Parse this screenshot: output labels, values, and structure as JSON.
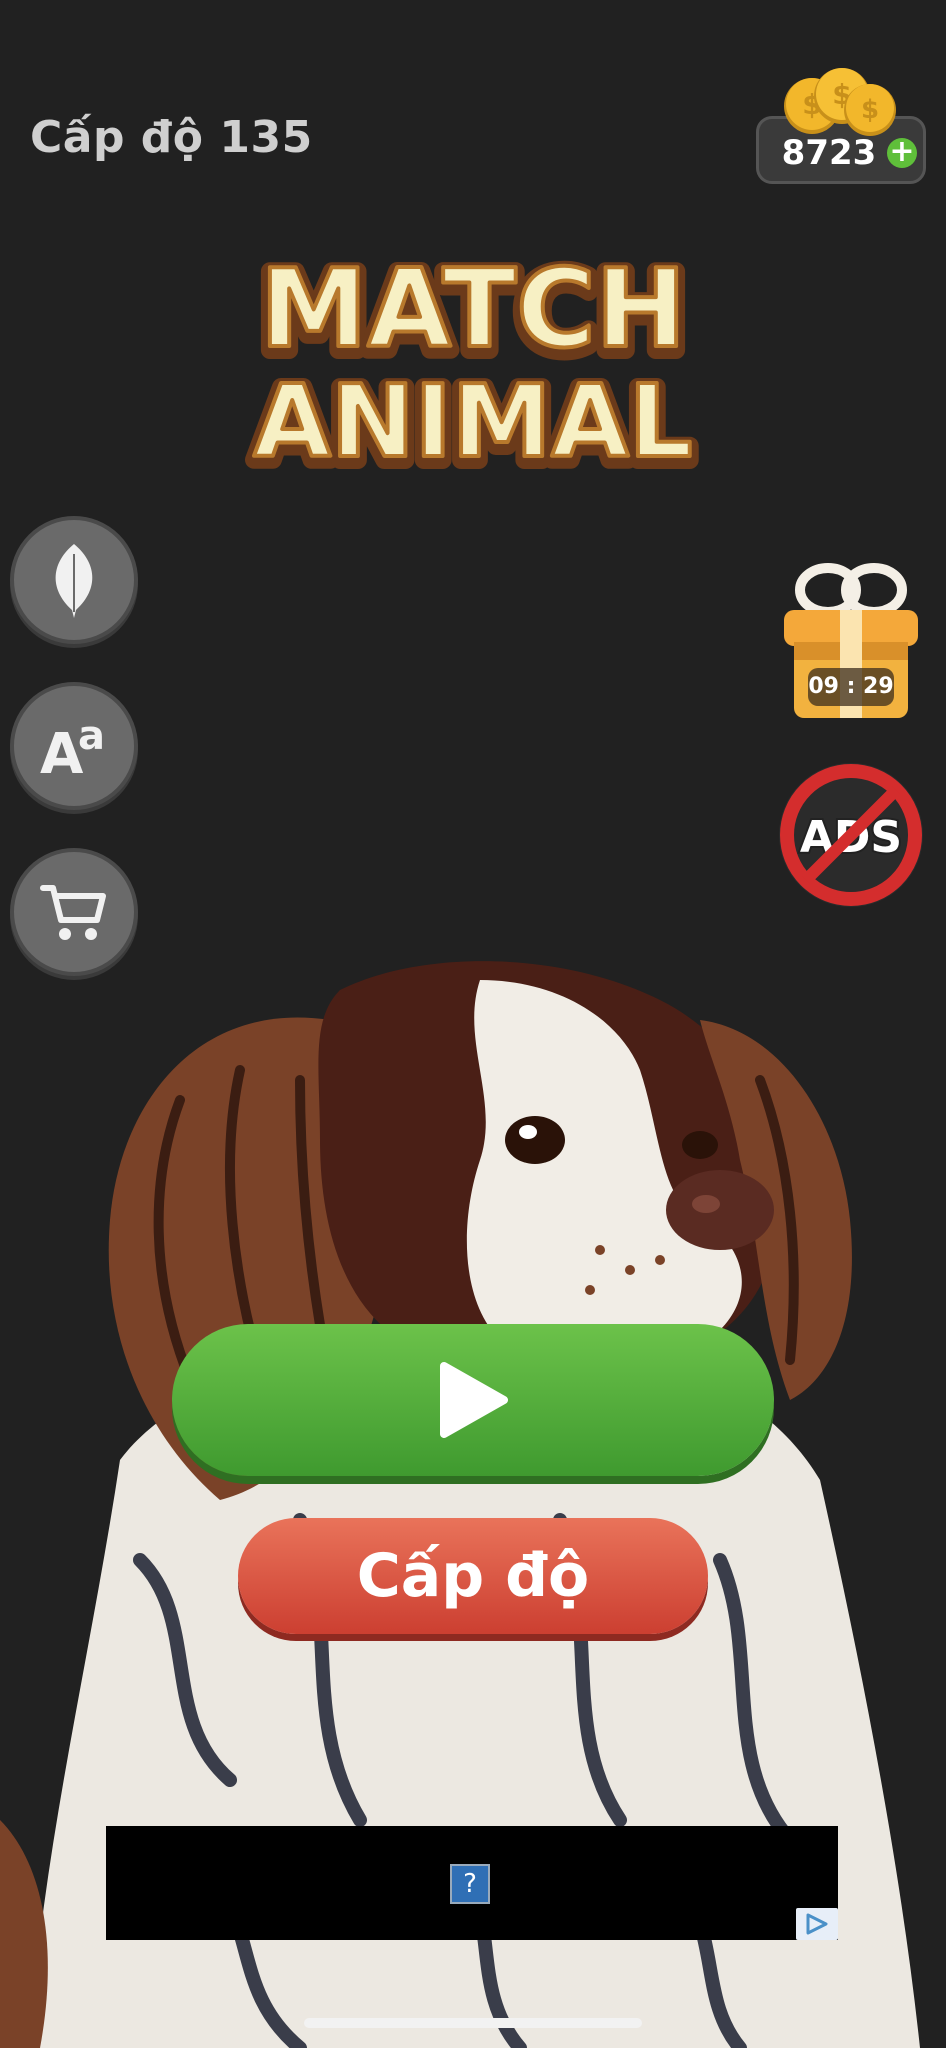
{
  "header": {
    "level_text": "Cấp độ 135",
    "coins": "8723"
  },
  "title": {
    "line1": "MATCH",
    "line2": "ANIMAL"
  },
  "side_buttons": [
    {
      "icon": "leaf-icon"
    },
    {
      "icon": "font-size-icon",
      "glyph": "Aa"
    },
    {
      "icon": "cart-icon"
    }
  ],
  "gift": {
    "timer": "09 : 29"
  },
  "no_ads": {
    "label": "ADS"
  },
  "buttons": {
    "level_label": "Cấp độ"
  },
  "ad": {
    "placeholder": "?"
  },
  "colors": {
    "background": "#212121",
    "play_green": "#4fae36",
    "level_red": "#dd5643",
    "title_cream": "#f7f0c4"
  }
}
